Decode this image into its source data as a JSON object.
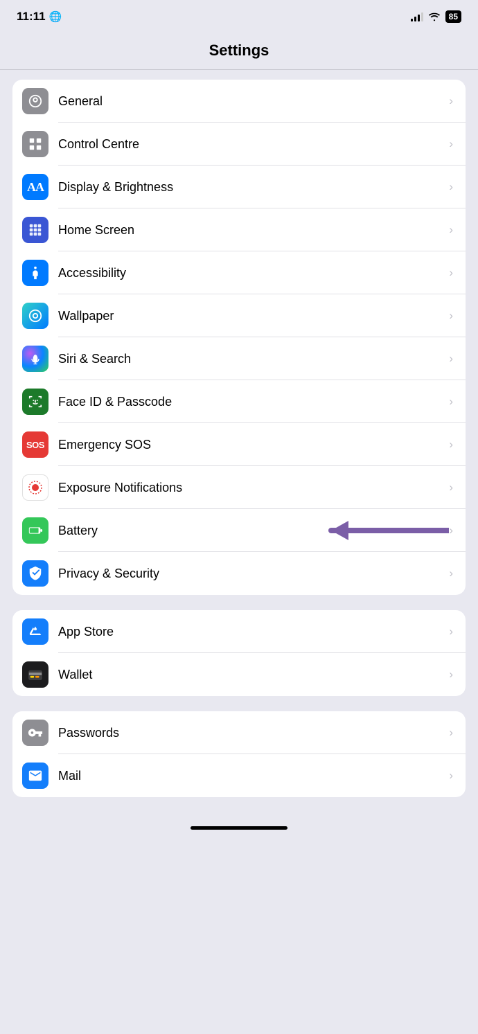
{
  "statusBar": {
    "time": "11:11",
    "battery": "85"
  },
  "pageTitle": "Settings",
  "groups": [
    {
      "id": "group1",
      "items": [
        {
          "id": "general",
          "label": "General",
          "iconColor": "gray",
          "iconType": "gear"
        },
        {
          "id": "control-centre",
          "label": "Control Centre",
          "iconColor": "gray",
          "iconType": "toggle"
        },
        {
          "id": "display-brightness",
          "label": "Display & Brightness",
          "iconColor": "blue",
          "iconType": "aa"
        },
        {
          "id": "home-screen",
          "label": "Home Screen",
          "iconColor": "homescreen",
          "iconType": "grid"
        },
        {
          "id": "accessibility",
          "label": "Accessibility",
          "iconColor": "accessibility",
          "iconType": "person"
        },
        {
          "id": "wallpaper",
          "label": "Wallpaper",
          "iconColor": "wallpaper",
          "iconType": "flower"
        },
        {
          "id": "siri-search",
          "label": "Siri & Search",
          "iconColor": "siri",
          "iconType": "siri"
        },
        {
          "id": "faceid-passcode",
          "label": "Face ID & Passcode",
          "iconColor": "faceid",
          "iconType": "faceid"
        },
        {
          "id": "emergency-sos",
          "label": "Emergency SOS",
          "iconColor": "red",
          "iconType": "sos"
        },
        {
          "id": "exposure",
          "label": "Exposure Notifications",
          "iconColor": "exposure",
          "iconType": "exposure"
        },
        {
          "id": "battery",
          "label": "Battery",
          "iconColor": "green",
          "iconType": "battery",
          "hasArrow": true
        },
        {
          "id": "privacy-security",
          "label": "Privacy & Security",
          "iconColor": "blue2",
          "iconType": "hand"
        }
      ]
    },
    {
      "id": "group2",
      "items": [
        {
          "id": "app-store",
          "label": "App Store",
          "iconColor": "blue2",
          "iconType": "appstore"
        },
        {
          "id": "wallet",
          "label": "Wallet",
          "iconColor": "dark",
          "iconType": "wallet"
        }
      ]
    },
    {
      "id": "group3",
      "items": [
        {
          "id": "passwords",
          "label": "Passwords",
          "iconColor": "gray2",
          "iconType": "key"
        },
        {
          "id": "mail",
          "label": "Mail",
          "iconColor": "blue3",
          "iconType": "mail"
        }
      ]
    }
  ]
}
